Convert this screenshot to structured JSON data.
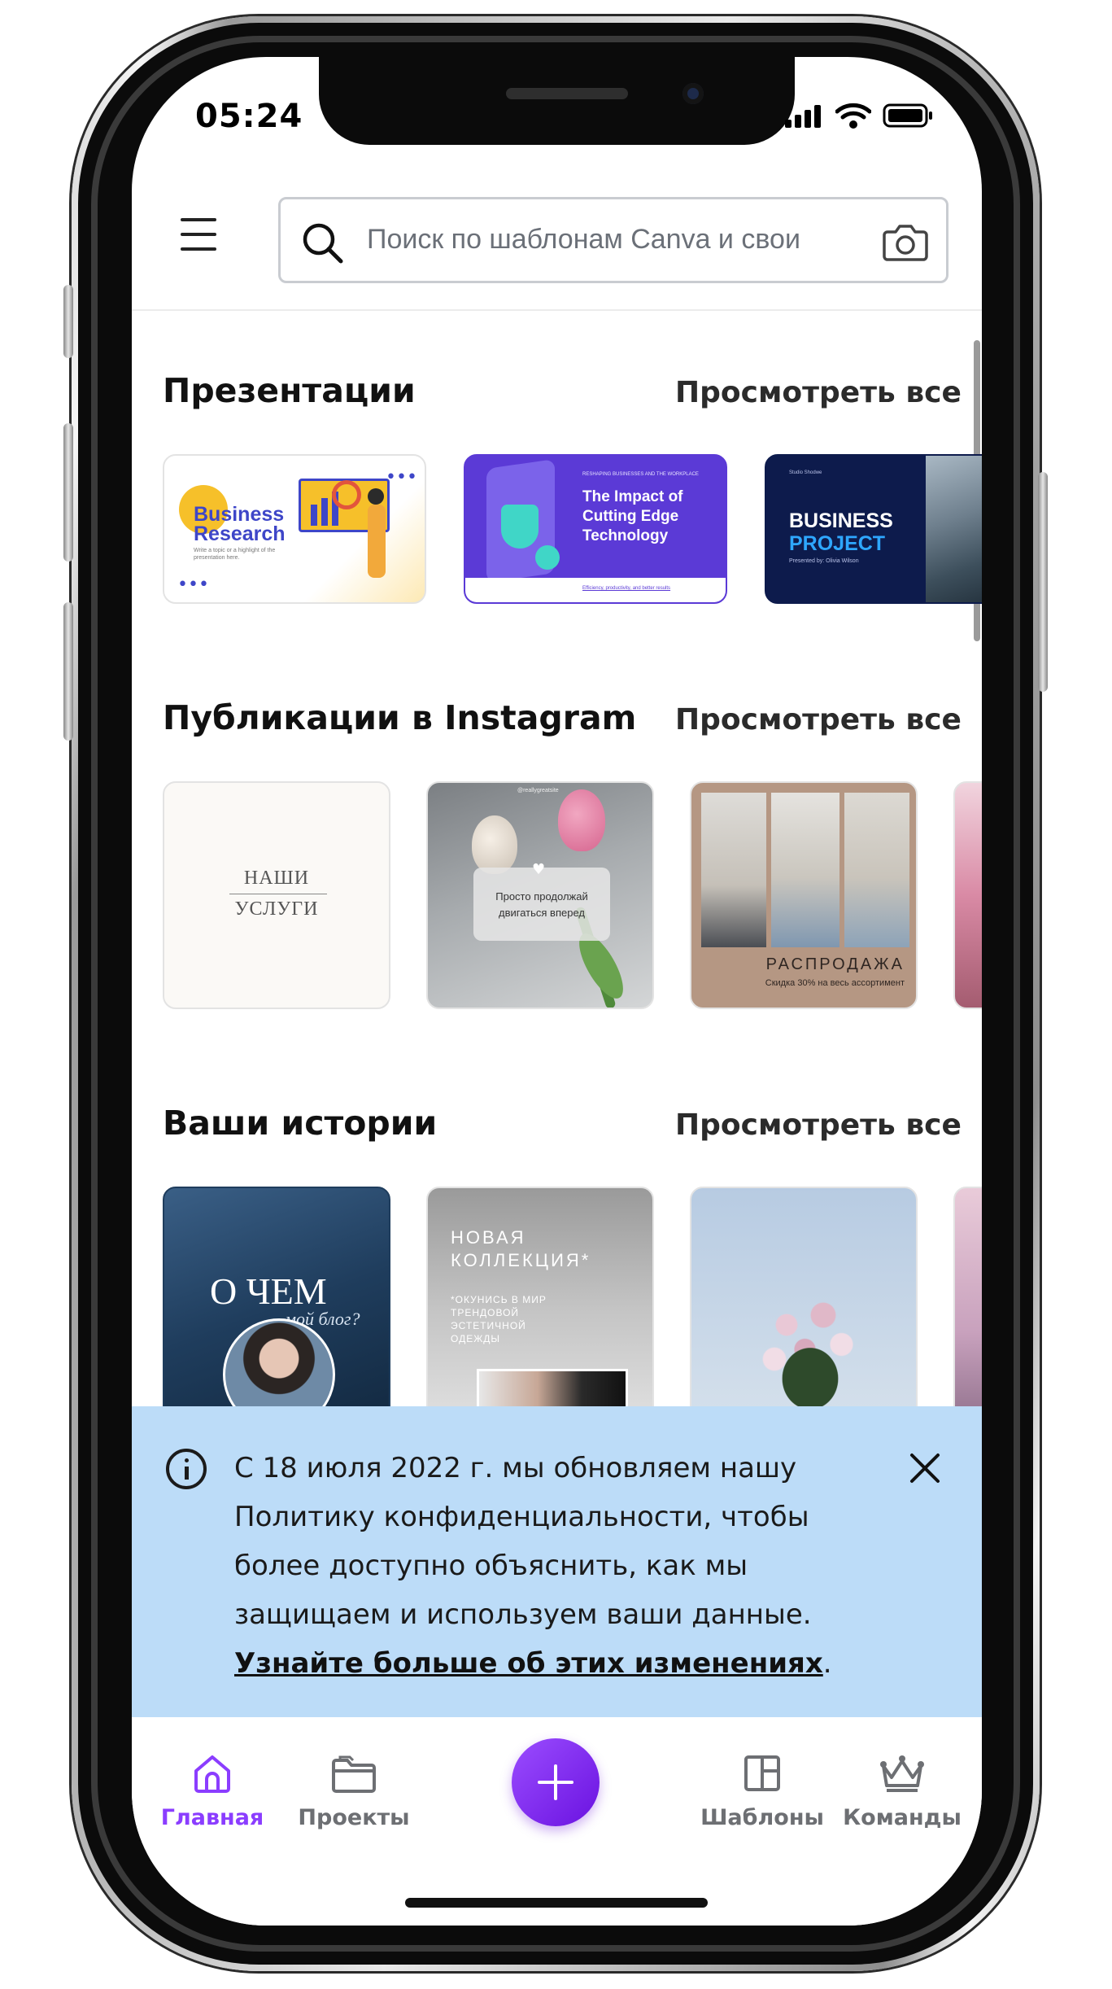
{
  "status_bar": {
    "time": "05:24"
  },
  "search": {
    "placeholder": "Поиск по шаблонам Canva и свои"
  },
  "sections": [
    {
      "title": "Презентации",
      "view_all": "Просмотреть все"
    },
    {
      "title": "Публикации в Instagram",
      "view_all": "Просмотреть все"
    },
    {
      "title": "Ваши истории",
      "view_all": "Просмотреть все"
    }
  ],
  "presentations": [
    {
      "line1": "Business",
      "line2": "Research",
      "caption": "Write a topic or a highlight of the presentation here."
    },
    {
      "kicker": "RESHAPING BUSINESSES AND THE WORKPLACE",
      "line1": "The Impact of",
      "line2": "Cutting Edge",
      "line3": "Technology",
      "footer": "Efficiency, productivity, and better results"
    },
    {
      "small": "Studio Shodwe",
      "line1": "BUSINESS",
      "line2": "PROJECT",
      "presenter": "Presented by: Olivia Wilson"
    }
  ],
  "instagram": [
    {
      "line1": "НАШИ",
      "line2": "УСЛУГИ"
    },
    {
      "handle": "@reallygreatsite",
      "line1": "Просто продолжай",
      "line2": "двигаться вперед"
    },
    {
      "title": "РАСПРОДАЖА",
      "subtitle": "Скидка 30% на весь ассортимент"
    }
  ],
  "stories": [
    {
      "title": "О ЧЕМ",
      "script": "мой блог?"
    },
    {
      "line1": "НОВАЯ",
      "line2": "КОЛЛЕКЦИЯ*",
      "body1": "*ОКУНИСЬ В МИР",
      "body2": "ТРЕНДОВОЙ",
      "body3": "ЭСТЕТИЧНОЙ",
      "body4": "ОДЕЖДЫ"
    }
  ],
  "banner": {
    "text": "С 18 июля 2022 г. мы обновляем нашу Политику конфиденциальности, чтобы более доступно объяснить, как мы защищаем и используем ваши данные.",
    "link": "Узнайте больше об этих изменениях",
    "link_suffix": "."
  },
  "tabs": [
    {
      "label": "Главная",
      "icon": "home-icon",
      "active": true
    },
    {
      "label": "Проекты",
      "icon": "folder-icon"
    },
    {
      "label": "Шаблоны",
      "icon": "templates-icon"
    },
    {
      "label": "Команды",
      "icon": "crown-icon"
    }
  ],
  "colors": {
    "accent": "#8b3dff",
    "banner_bg": "#bcdcf8",
    "presentation_purple": "#5b3ad6",
    "presentation_navy": "#0d1b4c"
  }
}
